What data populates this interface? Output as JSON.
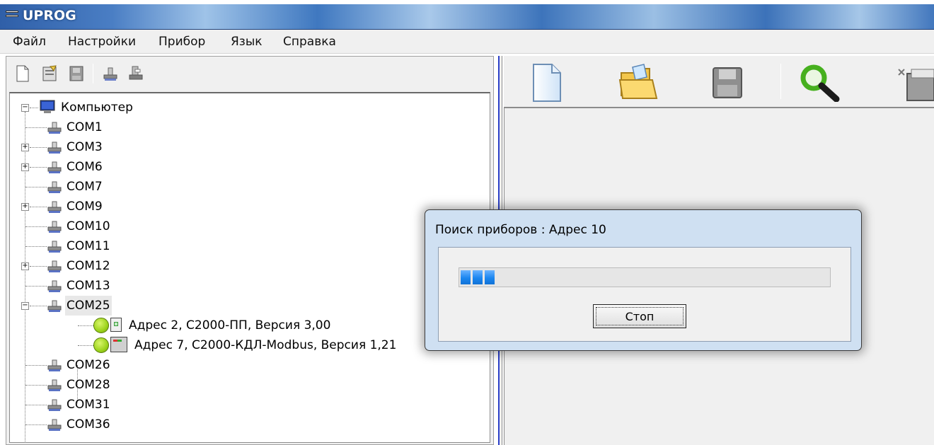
{
  "window": {
    "title": "UPROG"
  },
  "menu": [
    "Файл",
    "Настройки",
    "Прибор",
    "Язык",
    "Справка"
  ],
  "tree": {
    "root": "Компьютер",
    "ports": [
      {
        "label": "COM1",
        "expand": ""
      },
      {
        "label": "COM3",
        "expand": "+"
      },
      {
        "label": "COM6",
        "expand": "+"
      },
      {
        "label": "COM7",
        "expand": ""
      },
      {
        "label": "COM9",
        "expand": "+"
      },
      {
        "label": "COM10",
        "expand": ""
      },
      {
        "label": "COM11",
        "expand": ""
      },
      {
        "label": "COM12",
        "expand": "+"
      },
      {
        "label": "COM13",
        "expand": ""
      },
      {
        "label": "COM25",
        "expand": "−"
      },
      {
        "label": "COM26",
        "expand": ""
      },
      {
        "label": "COM28",
        "expand": ""
      },
      {
        "label": "COM31",
        "expand": ""
      },
      {
        "label": "COM36",
        "expand": ""
      }
    ],
    "devices": [
      "Адрес 2, С2000-ПП, Версия 3,00",
      "Адрес 7, С2000-КДЛ-Modbus, Версия 1,21"
    ]
  },
  "dialog": {
    "title": "Поиск приборов : Адрес 10",
    "stop_label": "Стоп",
    "progress_segments": 3
  },
  "colors": {
    "accent": "#1b86f0",
    "device_ok": "#9cd31c",
    "splitter": "#2b3fc9"
  }
}
